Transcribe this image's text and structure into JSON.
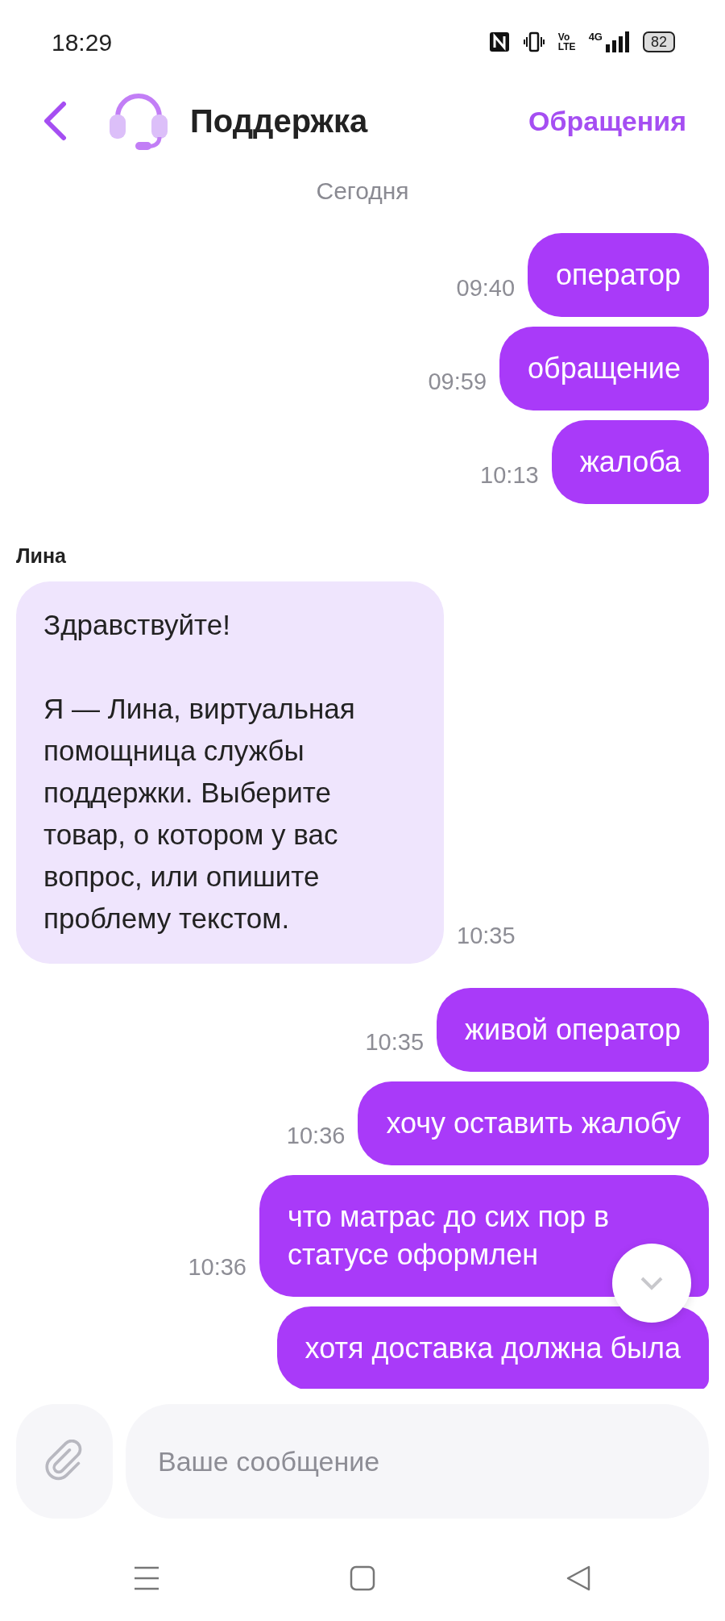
{
  "status_bar": {
    "time": "18:29",
    "volte": [
      "Vo",
      "LTE"
    ],
    "network": "4G",
    "battery": "82"
  },
  "header": {
    "title": "Поддержка",
    "action": "Обращения"
  },
  "date_separator": "Сегодня",
  "messages": [
    {
      "kind": "outgoing",
      "text": "оператор",
      "time": "09:40"
    },
    {
      "kind": "outgoing",
      "text": "обращение",
      "time": "09:59"
    },
    {
      "kind": "outgoing",
      "text": "жалоба",
      "time": "10:13"
    },
    {
      "kind": "incoming",
      "sender": "Лина",
      "text": "Здравствуйте!\n\nЯ — Лина, виртуальная помощница службы поддержки. Выберите товар, о котором у вас вопрос, или опишите проблему текстом.",
      "time": "10:35"
    },
    {
      "kind": "outgoing",
      "text": "живой оператор",
      "time": "10:35"
    },
    {
      "kind": "outgoing",
      "text": "хочу оставить жалобу",
      "time": "10:36"
    },
    {
      "kind": "outgoing",
      "text": "что матрас до сих пор в статусе оформлен",
      "time": "10:36"
    },
    {
      "kind": "outgoing",
      "text": "хотя доставка должна была"
    }
  ],
  "composer": {
    "placeholder": "Ваше сообщение"
  }
}
